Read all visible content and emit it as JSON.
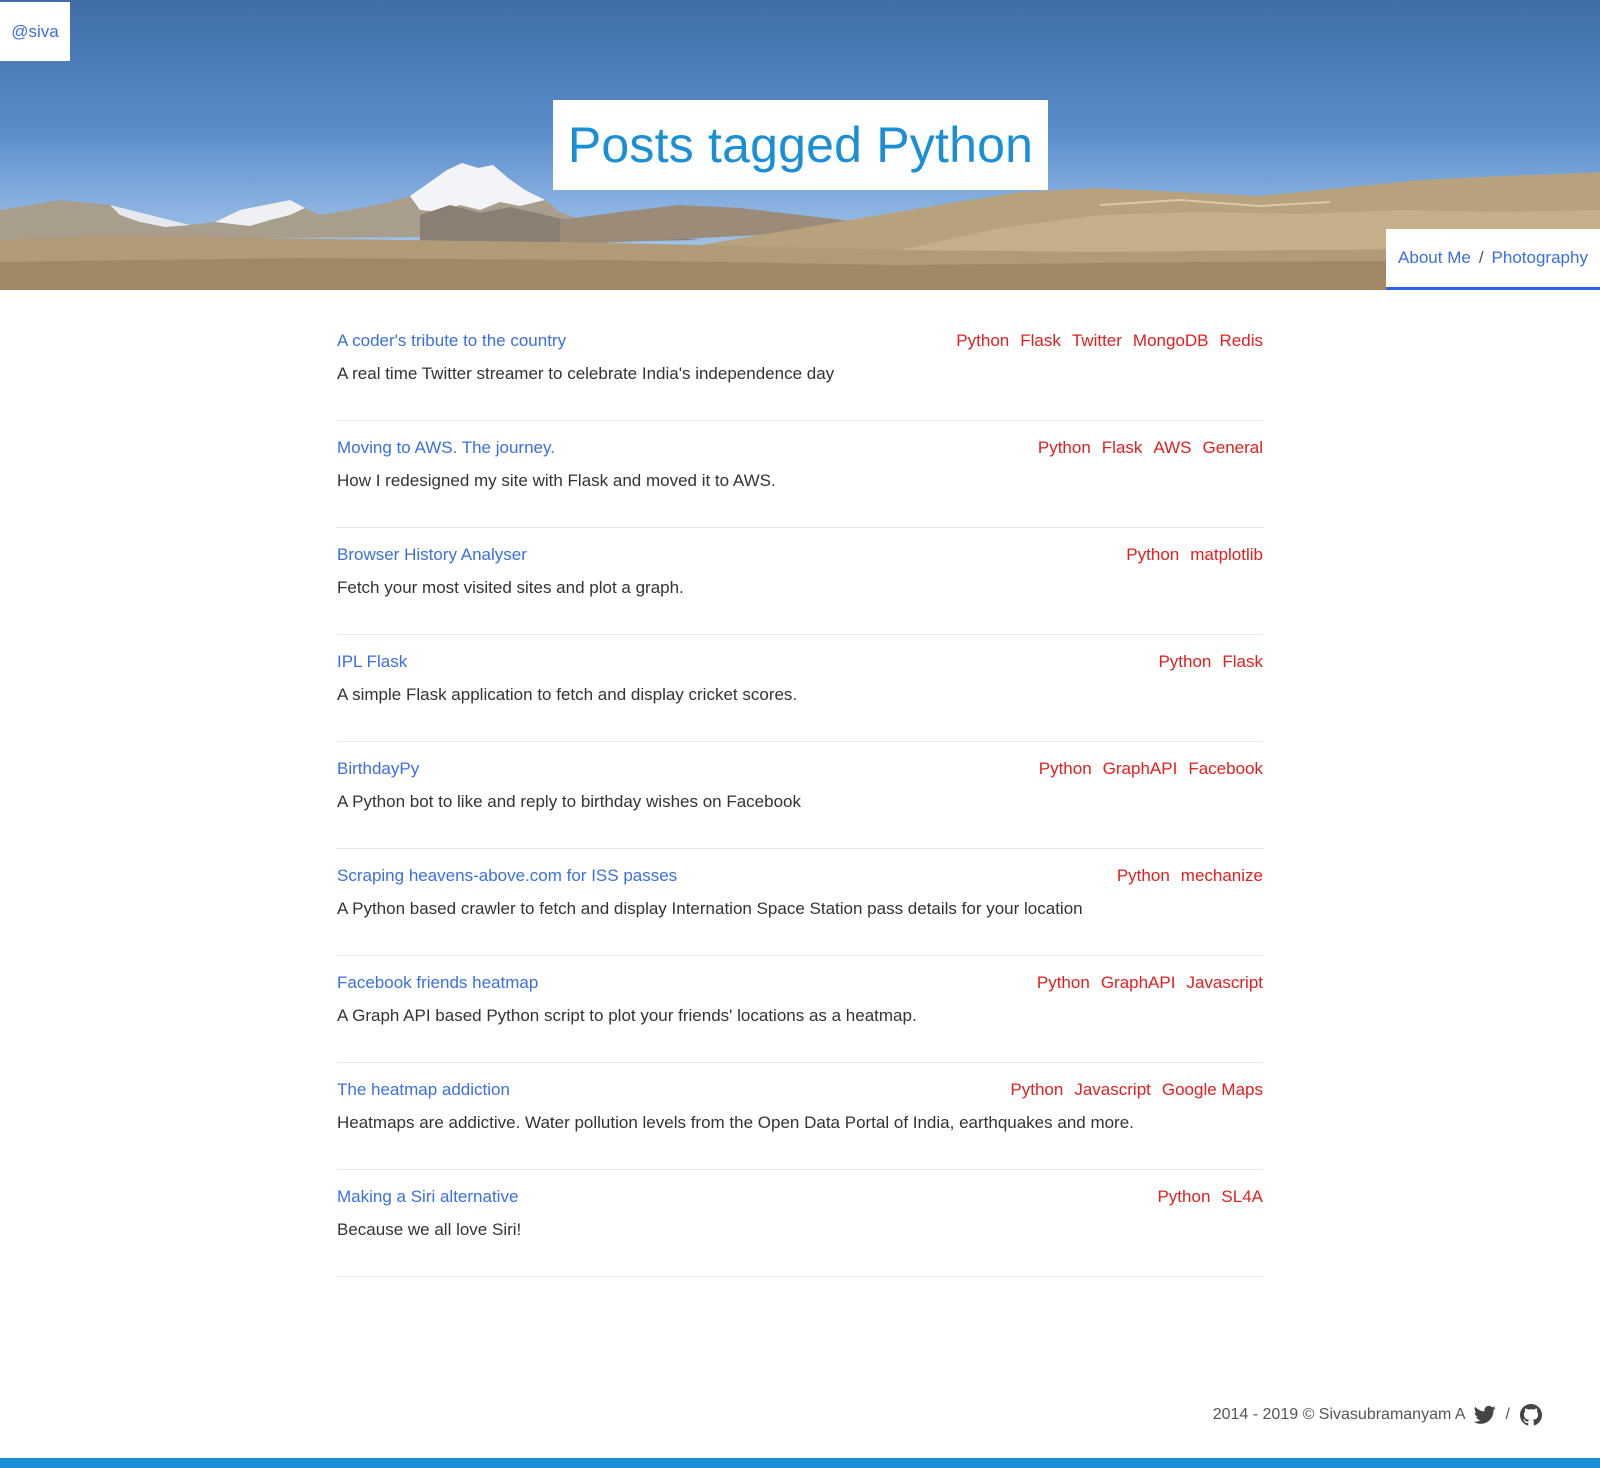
{
  "header": {
    "handle": "@siva",
    "title": "Posts tagged Python",
    "nav": [
      {
        "label": "About Me"
      },
      {
        "label": "Photography"
      }
    ],
    "nav_separator": "/"
  },
  "posts": [
    {
      "title": "A coder's tribute to the country",
      "description": "A real time Twitter streamer to celebrate India's independence day",
      "tags": [
        "Python",
        "Flask",
        "Twitter",
        "MongoDB",
        "Redis"
      ]
    },
    {
      "title": "Moving to AWS. The journey.",
      "description": "How I redesigned my site with Flask and moved it to AWS.",
      "tags": [
        "Python",
        "Flask",
        "AWS",
        "General"
      ]
    },
    {
      "title": "Browser History Analyser",
      "description": "Fetch your most visited sites and plot a graph.",
      "tags": [
        "Python",
        "matplotlib"
      ]
    },
    {
      "title": "IPL Flask",
      "description": "A simple Flask application to fetch and display cricket scores.",
      "tags": [
        "Python",
        "Flask"
      ]
    },
    {
      "title": "BirthdayPy",
      "description": "A Python bot to like and reply to birthday wishes on Facebook",
      "tags": [
        "Python",
        "GraphAPI",
        "Facebook"
      ]
    },
    {
      "title": "Scraping heavens-above.com for ISS passes",
      "description": "A Python based crawler to fetch and display Internation Space Station pass details for your location",
      "tags": [
        "Python",
        "mechanize"
      ]
    },
    {
      "title": "Facebook friends heatmap",
      "description": "A Graph API based Python script to plot your friends' locations as a heatmap.",
      "tags": [
        "Python",
        "GraphAPI",
        "Javascript"
      ]
    },
    {
      "title": "The heatmap addiction",
      "description": "Heatmaps are addictive. Water pollution levels from the Open Data Portal of India, earthquakes and more.",
      "tags": [
        "Python",
        "Javascript",
        "Google Maps"
      ]
    },
    {
      "title": "Making a Siri alternative",
      "description": "Because we all love Siri!",
      "tags": [
        "Python",
        "SL4A"
      ]
    }
  ],
  "footer": {
    "copyright": "2014 - 2019 © Sivasubramanyam A",
    "separator": "/",
    "icons": [
      "twitter-icon",
      "github-icon"
    ]
  },
  "colors": {
    "link": "#3b6fe0",
    "title": "#1a8fd8",
    "tag": "#e02020",
    "nav_underline": "#2f63e6",
    "bottom_bar": "#1a8fd8"
  }
}
